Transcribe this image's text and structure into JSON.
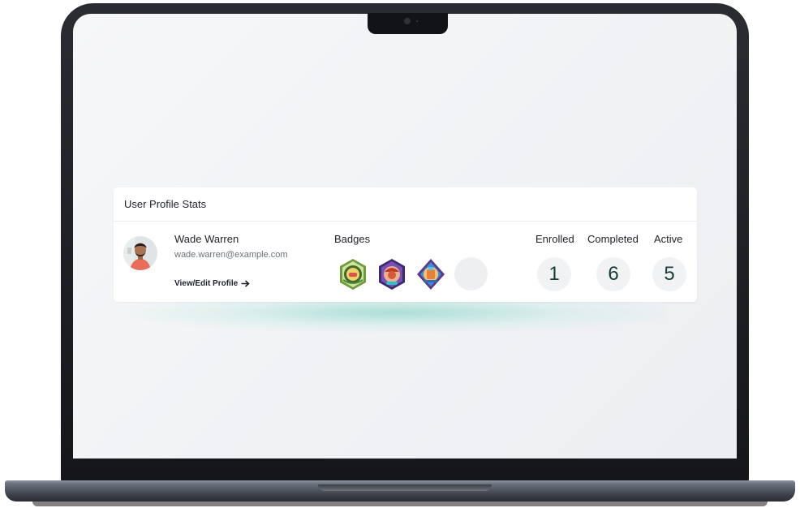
{
  "card": {
    "title": "User Profile Stats"
  },
  "user": {
    "name": "Wade Warren",
    "email": "wade.warren@example.com",
    "profile_link_label": "View/Edit Profile",
    "profile_link_icon": "arrow-right-icon"
  },
  "badges": {
    "label": "Badges",
    "items": [
      {
        "icon": "green-laurel-badge-icon",
        "accent": "#7aa84a"
      },
      {
        "icon": "purple-hexagon-badge-icon",
        "accent": "#5b3a8c"
      },
      {
        "icon": "blue-shield-badge-icon",
        "accent": "#3f6fb0"
      },
      {
        "icon": "empty-badge-slot",
        "accent": "#eeeff1"
      }
    ]
  },
  "stats": [
    {
      "label": "Enrolled",
      "value": "1"
    },
    {
      "label": "Completed",
      "value": "6"
    },
    {
      "label": "Active",
      "value": "5"
    }
  ],
  "colors": {
    "stat_number": "#173e39",
    "glow": "#96d7cd"
  }
}
